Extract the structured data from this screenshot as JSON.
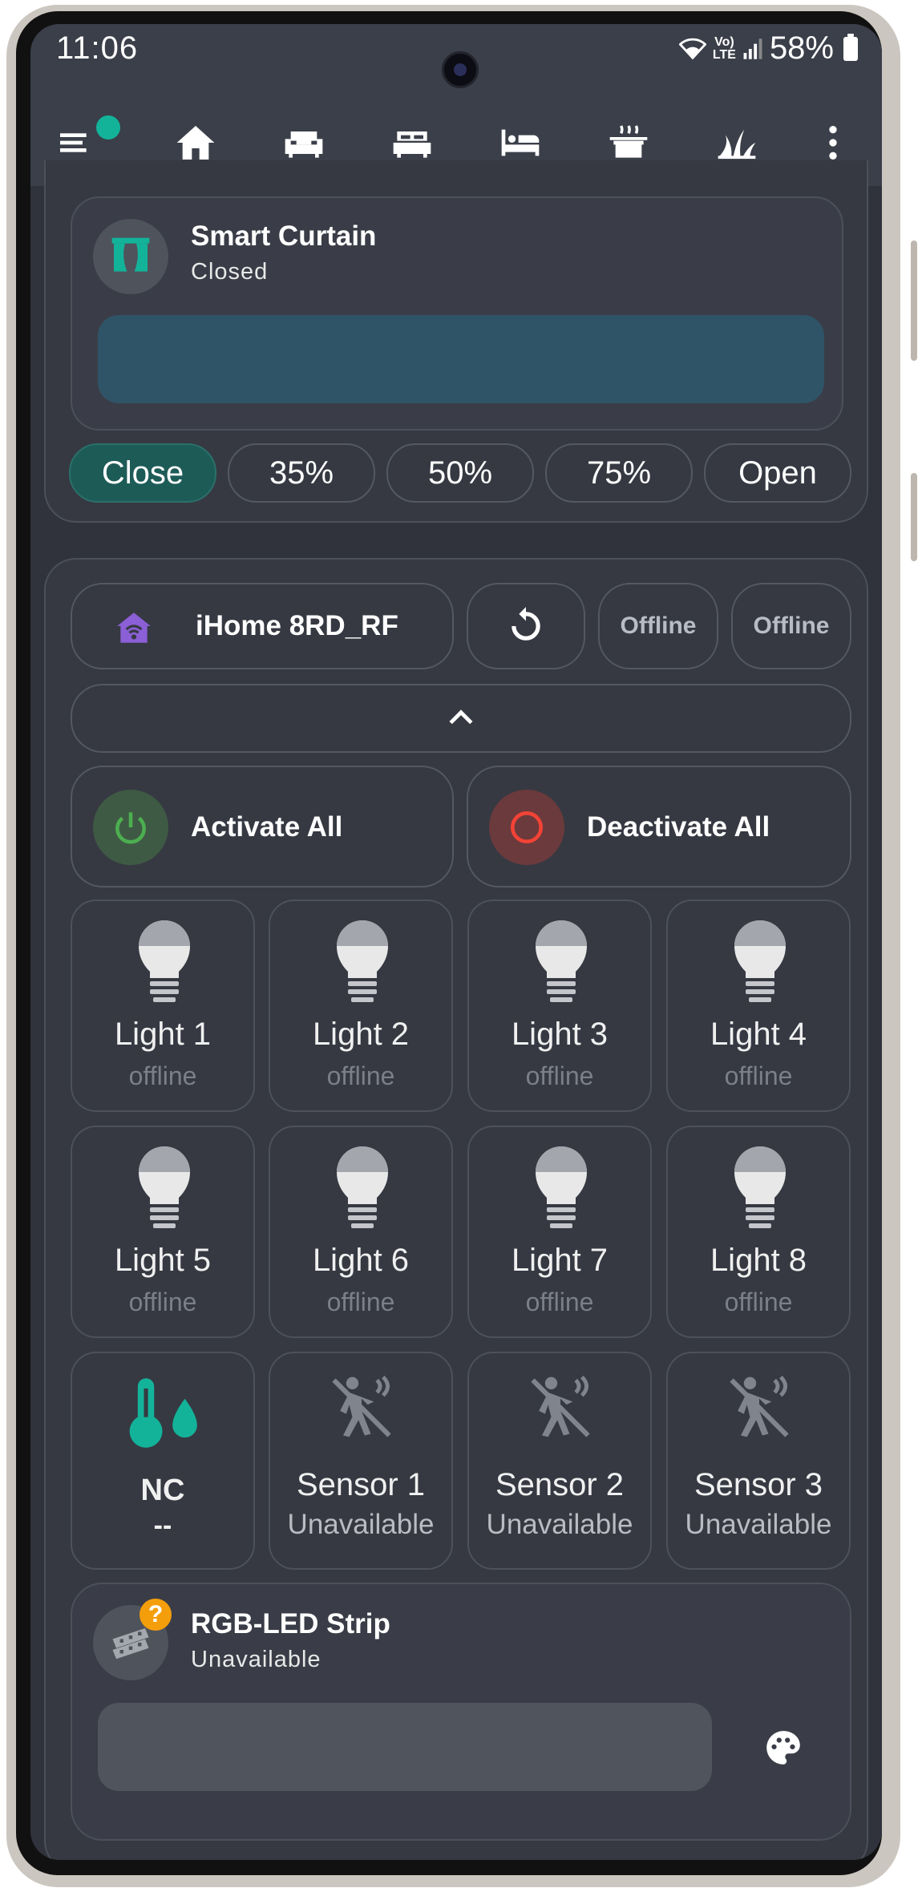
{
  "status_bar": {
    "time": "11:06",
    "lte_line1": "Vo)",
    "lte_line2": "LTE",
    "battery": "58%"
  },
  "nav": {
    "items": [
      {
        "name": "menu",
        "icon": "menu-icon"
      },
      {
        "name": "home",
        "icon": "home-icon",
        "active": true
      },
      {
        "name": "living",
        "icon": "sofa-icon"
      },
      {
        "name": "bedroom",
        "icon": "double-bed-icon"
      },
      {
        "name": "guest",
        "icon": "bed-icon"
      },
      {
        "name": "kitchen",
        "icon": "pot-steam-icon"
      },
      {
        "name": "garden",
        "icon": "grass-icon"
      },
      {
        "name": "more",
        "icon": "more-vert-icon"
      }
    ]
  },
  "curtain": {
    "title": "Smart Curtain",
    "state": "Closed",
    "icon": "curtain-icon",
    "position_percent": 0,
    "presets": [
      "Close",
      "35%",
      "50%",
      "75%",
      "Open"
    ],
    "active_preset": "Close"
  },
  "hub": {
    "name": "iHome 8RD_RF",
    "icon": "home-wifi-icon",
    "status1": "Offline",
    "status2": "Offline",
    "activate_all": "Activate All",
    "deactivate_all": "Deactivate All"
  },
  "lights": [
    {
      "label": "Light 1",
      "state": "offline"
    },
    {
      "label": "Light 2",
      "state": "offline"
    },
    {
      "label": "Light 3",
      "state": "offline"
    },
    {
      "label": "Light 4",
      "state": "offline"
    },
    {
      "label": "Light 5",
      "state": "offline"
    },
    {
      "label": "Light 6",
      "state": "offline"
    },
    {
      "label": "Light 7",
      "state": "offline"
    },
    {
      "label": "Light 8",
      "state": "offline"
    }
  ],
  "climate": {
    "label": "NC",
    "value": "--",
    "icon": "thermometer-water-icon"
  },
  "sensors": [
    {
      "label": "Sensor 1",
      "state": "Unavailable",
      "icon": "motion-sensor-off-icon"
    },
    {
      "label": "Sensor 2",
      "state": "Unavailable",
      "icon": "motion-sensor-off-icon"
    },
    {
      "label": "Sensor 3",
      "state": "Unavailable",
      "icon": "motion-sensor-off-icon"
    }
  ],
  "rgb": {
    "title": "RGB-LED Strip",
    "state": "Unavailable",
    "badge": "?",
    "icon": "led-strip-icon",
    "palette_icon": "palette-icon"
  },
  "colors": {
    "accent": "#13b39a",
    "background": "#30333c",
    "card": "#3a3d47",
    "curtain_bar": "#2f5468",
    "hub_icon": "#8b5fd6",
    "power_on": "#4caf50",
    "power_off": "#f44336",
    "badge": "#f59e0b"
  }
}
